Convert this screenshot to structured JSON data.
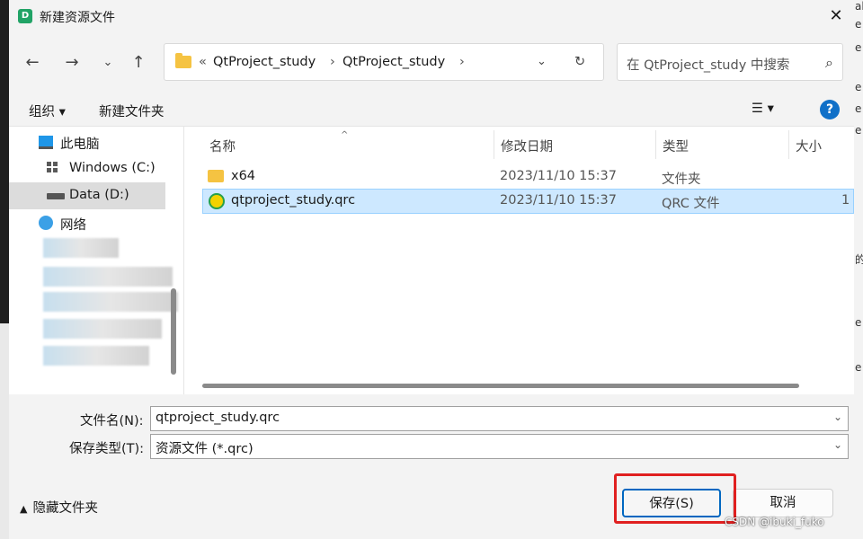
{
  "window": {
    "title": "新建资源文件",
    "app_icon_letter": "D"
  },
  "address": {
    "overflow": "«",
    "crumbs": [
      "QtProject_study",
      "QtProject_study"
    ],
    "sep": "›"
  },
  "search": {
    "placeholder": "在 QtProject_study 中搜索"
  },
  "toolbar": {
    "organize": "组织 ▾",
    "new_folder": "新建文件夹",
    "view": "☰ ▾",
    "help": "?"
  },
  "nav": {
    "this_pc": "此电脑",
    "windows_c": "Windows (C:)",
    "data_d": "Data (D:)",
    "network": "网络"
  },
  "columns": {
    "name": "名称",
    "date": "修改日期",
    "type": "类型",
    "size": "大小"
  },
  "files": [
    {
      "name": "x64",
      "date": "2023/11/10 15:37",
      "type": "文件夹",
      "size": ""
    },
    {
      "name": "qtproject_study.qrc",
      "date": "2023/11/10 15:37",
      "type": "QRC 文件",
      "size": "1"
    }
  ],
  "form": {
    "filename_label": "文件名(N):",
    "filename_value": "qtproject_study.qrc",
    "filetype_label": "保存类型(T):",
    "filetype_value": "资源文件 (*.qrc)"
  },
  "footer": {
    "hide_folders": "隐藏文件夹",
    "save": "保存(S)",
    "cancel": "取消"
  },
  "watermark": "CSDN @ibuki_fuko",
  "colors": {
    "accent": "#0067c0",
    "selection": "#cde8ff",
    "highlight_box": "#e02020"
  },
  "icons": [
    "folder-icon",
    "qrc-file-icon",
    "computer-icon",
    "drive-icon",
    "network-icon",
    "search-icon",
    "help-icon"
  ]
}
